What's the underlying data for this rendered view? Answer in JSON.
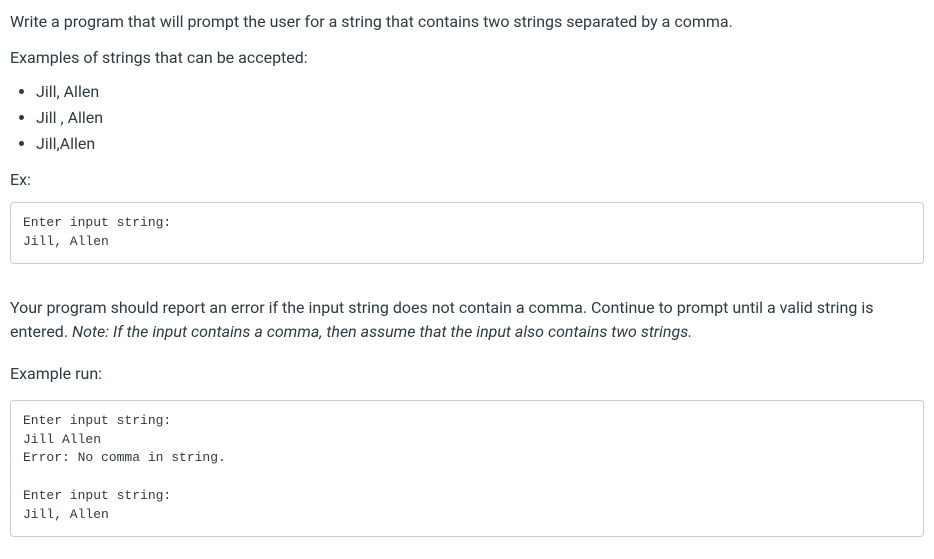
{
  "intro": "Write a program that will prompt the user for a string that contains two strings separated by a comma.",
  "examples_label": "Examples of strings that can be accepted:",
  "examples": {
    "items": [
      "Jill, Allen",
      "Jill , Allen",
      "Jill,Allen"
    ]
  },
  "ex_label": "Ex:",
  "code_block_1": "Enter input string:\nJill, Allen",
  "error_paragraph_pre": "Your program should report an error if the input string does not contain a comma. Continue to prompt until a valid string is entered. ",
  "error_paragraph_note": "Note: If the input contains a comma, then assume that the input also contains two strings.",
  "example_run_label": "Example run:",
  "code_block_2": "Enter input string:\nJill Allen\nError: No comma in string.\n\nEnter input string:\nJill, Allen"
}
